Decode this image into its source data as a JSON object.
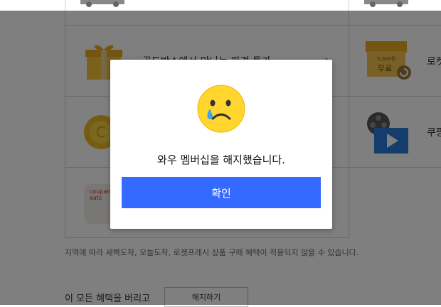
{
  "benefits": {
    "row1_label": "골드박스에서 만나는 파격 특가",
    "row1_right_label": "로켓",
    "row2_right_label": "쿠팡",
    "free_badge_text": "무료",
    "free_badge_amount": "5,000원"
  },
  "notice": "지역에 따라 새벽도착, 오늘도착, 로켓프레시 상품 구매 혜택이 적용되지 않을 수 있습니다.",
  "bottom": {
    "text": "이 모든 혜택을 버리고",
    "cancel_label": "해지하기"
  },
  "coupang_eats_logo_text": "coupang eats",
  "modal": {
    "message": "와우 멤버십을 해지했습니다.",
    "confirm_label": "확인"
  },
  "colors": {
    "confirm_button": "#346aff",
    "overlay": "rgba(0,0,0,0.5)"
  }
}
